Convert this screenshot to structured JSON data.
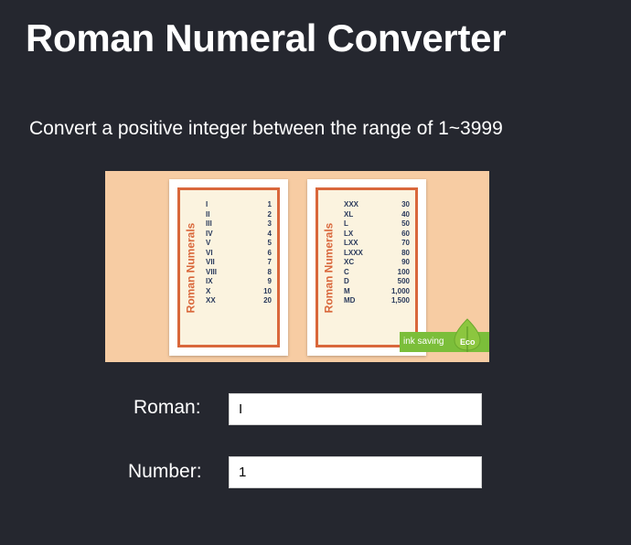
{
  "header": {
    "title": "Roman Numeral Converter",
    "subtitle": "Convert a positive integer between the range of 1~3999"
  },
  "reference_image": {
    "card_left": {
      "heading": "Roman Numerals",
      "rows": [
        [
          "I",
          "1"
        ],
        [
          "II",
          "2"
        ],
        [
          "III",
          "3"
        ],
        [
          "IV",
          "4"
        ],
        [
          "V",
          "5"
        ],
        [
          "VI",
          "6"
        ],
        [
          "VII",
          "7"
        ],
        [
          "VIII",
          "8"
        ],
        [
          "IX",
          "9"
        ],
        [
          "X",
          "10"
        ],
        [
          "XX",
          "20"
        ]
      ]
    },
    "card_right": {
      "heading": "Roman Numerals",
      "rows": [
        [
          "XXX",
          "30"
        ],
        [
          "XL",
          "40"
        ],
        [
          "L",
          "50"
        ],
        [
          "LX",
          "60"
        ],
        [
          "LXX",
          "70"
        ],
        [
          "LXXX",
          "80"
        ],
        [
          "XC",
          "90"
        ],
        [
          "C",
          "100"
        ],
        [
          "D",
          "500"
        ],
        [
          "M",
          "1,000"
        ],
        [
          "MD",
          "1,500"
        ]
      ]
    },
    "badge": {
      "text": "ink saving",
      "eco": "Eco"
    },
    "colors": {
      "background": "#f7cca3",
      "border": "#d9673b",
      "badge": "#7bbe3a"
    }
  },
  "form": {
    "roman_label": "Roman:",
    "roman_value": "I",
    "number_label": "Number:",
    "number_value": "1"
  }
}
